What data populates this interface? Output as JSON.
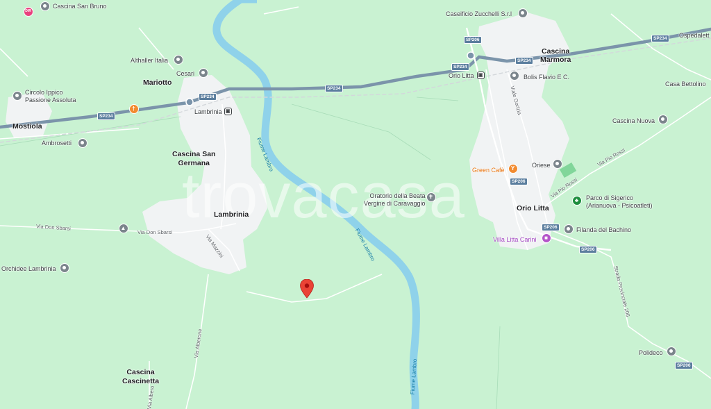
{
  "map": {
    "watermark": "trovacasa",
    "colors": {
      "land": "#c9f2d2",
      "built_up": "#f1f3f4",
      "river": "#8fd2ea",
      "highway": "#7b94aa",
      "marker": "#ea4335"
    },
    "towns": {
      "mariotto": "Mariotto",
      "mostiola": "Mostiola",
      "cascina_san_germana": "Cascina San\nGermana",
      "lambrinia": "Lambrinia",
      "cascina_cascinetta": "Cascina\nCascinetta",
      "cascina_marmora": "Cascina\nMarmora",
      "orio_litta": "Orio Litta",
      "ospedaletto": "Ospedalett"
    },
    "pois": {
      "cascina_san_bruno": "Cascina San Bruno",
      "althaller": "Althaller Italia",
      "cesari": "Cesari",
      "circolo": "Circolo Ippico\nPassione Assoluta",
      "lambrinia_station": "Lambrinia",
      "ambrosetti": "Ambrosetti",
      "orchidee": "Orchidee Lambrinia",
      "oratorio": "Oratorio della Beata\nVergine di Caravaggio",
      "caseificio": "Caseificio Zucchelli S.r.l",
      "orio_station": "Orio Litta",
      "bolis": "Bolis Flavio E C.",
      "casa_bettolino": "Casa Bettolino",
      "cascina_nuova": "Cascina Nuova",
      "green_cafe": "Green Cafè",
      "oriese": "Oriese",
      "parco": "Parco di Sigerico\n(Arianuova - Psicoatleti)",
      "filanda": "Filanda del Bachino",
      "villa": "Villa Litta Carini",
      "polideco": "Polideco"
    },
    "roads": {
      "via_don_sbarsi": "Via Don Sbarsi",
      "via_mazzini": "Via Mazzini",
      "via_alberone": "Via Alberone",
      "via_alberone_2": "Via Albero",
      "viale_gorizia": "Viale Gorizia",
      "via_pio_rossi": "Via Pio Rossi",
      "strada_prov_206": "Strada Provinciale 206"
    },
    "rivers": {
      "fiume_lambro": "Fiume Lambro"
    },
    "shields": {
      "sp234": "SP234",
      "sp206": "SP206"
    }
  }
}
